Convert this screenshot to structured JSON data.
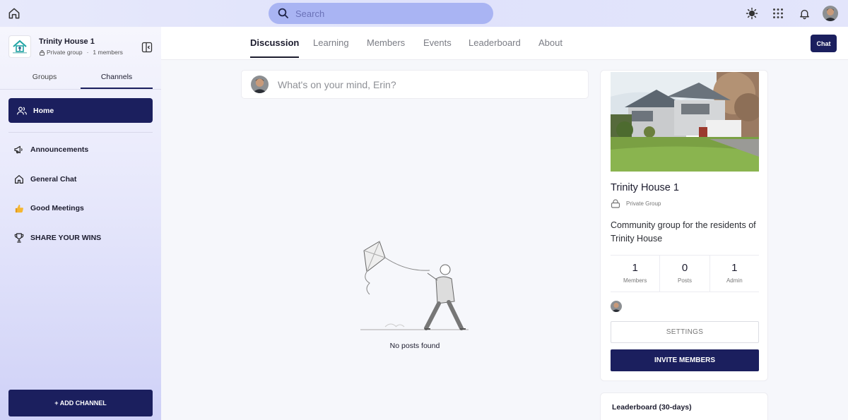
{
  "topbar": {
    "search_placeholder": "Search"
  },
  "group": {
    "name": "Trinity House 1",
    "privacy": "Private group",
    "members": "1 members"
  },
  "sidebar": {
    "tabs": [
      "Groups",
      "Channels"
    ],
    "active_tab": "Channels",
    "home_label": "Home",
    "items": [
      {
        "label": "Announcements",
        "icon": "megaphone-icon"
      },
      {
        "label": "General Chat",
        "icon": "house-icon"
      },
      {
        "label": "Good Meetings",
        "icon": "thumbs-up-icon"
      },
      {
        "label": "SHARE YOUR WINS",
        "icon": "trophy-icon"
      }
    ],
    "add_channel_label": "+ ADD CHANNEL"
  },
  "main": {
    "tabs": [
      "Discussion",
      "Learning",
      "Members",
      "Events",
      "Leaderboard",
      "About"
    ],
    "active_tab": "Discussion",
    "chat_label": "Chat",
    "composer_placeholder": "What's on your mind, Erin?",
    "empty_text": "No posts found"
  },
  "card": {
    "title": "Trinity House 1",
    "privacy": "Private Group",
    "description": "Community group for the residents of Trinity House",
    "stats": [
      {
        "value": "1",
        "label": "Members"
      },
      {
        "value": "0",
        "label": "Posts"
      },
      {
        "value": "1",
        "label": "Admin"
      }
    ],
    "settings_label": "SETTINGS",
    "invite_label": "INVITE MEMBERS"
  },
  "leaderboard": {
    "title": "Leaderboard (30-days)"
  },
  "colors": {
    "primary": "#1b1f5e",
    "search_bg": "#a9b4f3"
  }
}
